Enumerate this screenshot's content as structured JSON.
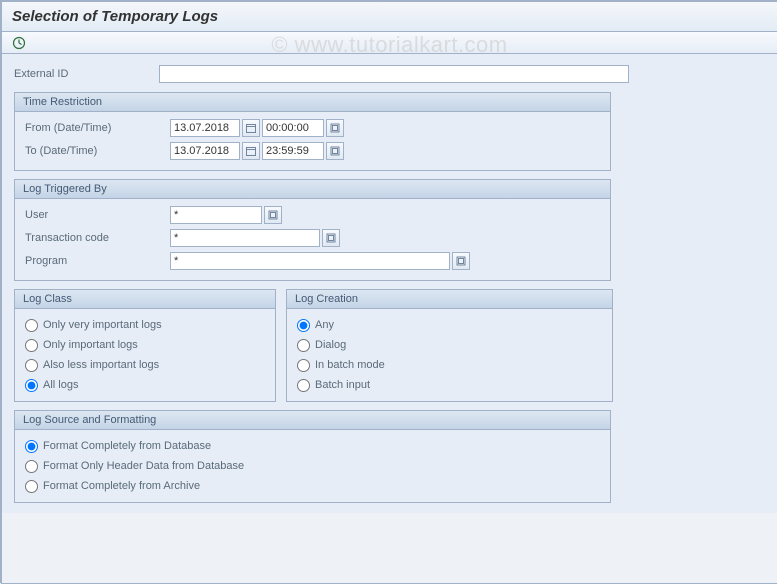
{
  "title": "Selection of Temporary Logs",
  "watermark": "© www.tutorialkart.com",
  "externalIdLabel": "External ID",
  "externalIdValue": "",
  "timeRestriction": {
    "title": "Time Restriction",
    "fromLabel": "From (Date/Time)",
    "fromDate": "13.07.2018",
    "fromTime": "00:00:00",
    "toLabel": "To (Date/Time)",
    "toDate": "13.07.2018",
    "toTime": "23:59:59"
  },
  "logTriggeredBy": {
    "title": "Log Triggered By",
    "userLabel": "User",
    "userValue": "*",
    "tcodeLabel": "Transaction code",
    "tcodeValue": "*",
    "programLabel": "Program",
    "programValue": "*"
  },
  "logClass": {
    "title": "Log Class",
    "options": [
      "Only very important logs",
      "Only important logs",
      "Also less important logs",
      "All logs"
    ],
    "selected": 3
  },
  "logCreation": {
    "title": "Log Creation",
    "options": [
      "Any",
      "Dialog",
      "In batch mode",
      "Batch input"
    ],
    "selected": 0
  },
  "logSource": {
    "title": "Log Source and Formatting",
    "options": [
      "Format Completely from Database",
      "Format Only Header Data from Database",
      "Format Completely from Archive"
    ],
    "selected": 0
  }
}
